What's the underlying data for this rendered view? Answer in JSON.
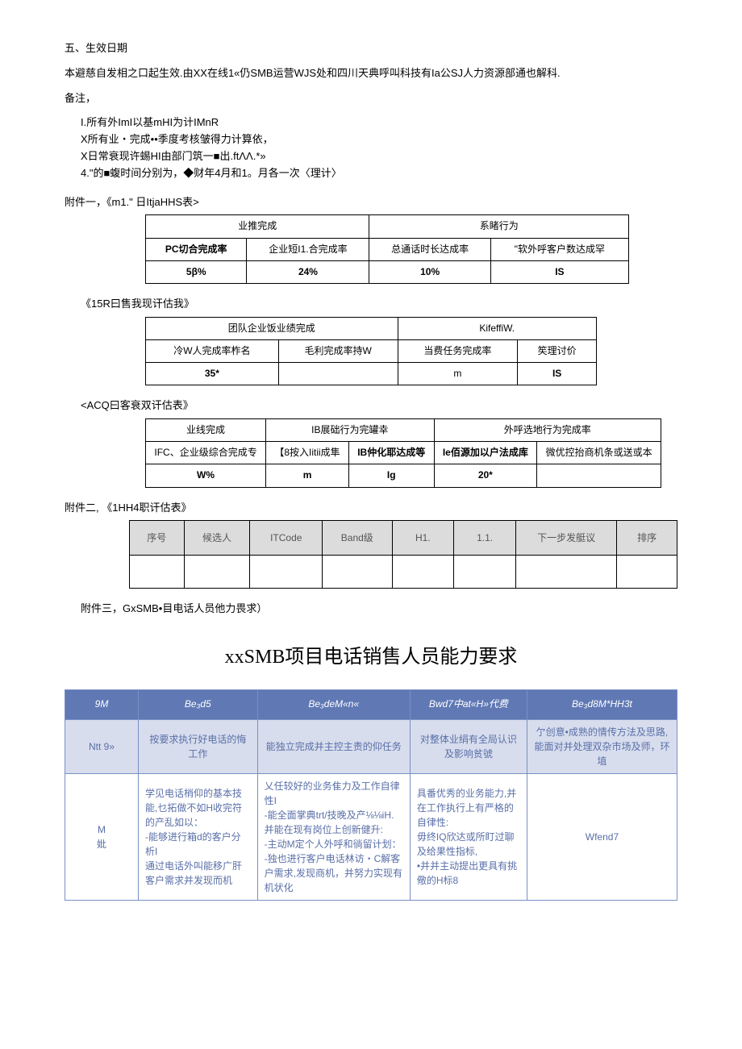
{
  "section5_title": "五、生效日期",
  "section5_body": "本避慈自发相之口起生效.由XX在线1«仍SMB运营WJS处和四川天典呼叫科技有Ia公SJ人力资源部通也解科.",
  "notes_title": "备注，",
  "notes": [
    "I.所有外ImI以基mHI为计IMnR",
    "X所有业・完成••季度考核皱得力计算依，",
    "X日常衰现许蜴HI由部门筑一■出.ftΛΛ.*»",
    "4.\"的■蝮时间分别为，◆财年4月和1。月各一次〈理计〉"
  ],
  "attach1_label": "附件一，《m1.\" 日ItjaHHS表>",
  "t1": {
    "h1": "业推完成",
    "h2": "系睹行为",
    "c1": "PC切合完成率",
    "c2": "企业短I1.合完成率",
    "c3": "总通话时长达成率",
    "c4": "\"软外呼客户数达成罕",
    "v1": "5β%",
    "v2": "24%",
    "v3": "10%",
    "v4": "IS"
  },
  "t2_label": "《15R曰售我现讦估我》",
  "t2": {
    "h1": "团队企业饭业绩完成",
    "h2": "KifeffiW.",
    "c1": "冷W人完成率柞名",
    "c2": "毛利完成率持W",
    "c3": "当费任务完成率",
    "c4": "笶理讨价",
    "v1": "35*",
    "v2": "",
    "v3": "m",
    "v4": "IS"
  },
  "t3_label": "<ACQ曰客衰双讦估表》",
  "t3": {
    "h1": "业线完成",
    "h2": "IB展础行为完罐幸",
    "h3": "外呼选地行为完成率",
    "c1": "IFC、企业级综合完成专",
    "c2": "【8按入Iitii成隼",
    "c3": "IB仲化耶达成等",
    "c4": "Ie佰源加以户法成库",
    "c5": "微优控抬商机条或送或本",
    "v1": "W%",
    "v2": "m",
    "v3": "Ig",
    "v4": "20*",
    "v5": ""
  },
  "attach2_label": "附件二, 《1HH4职讦估表》",
  "t4": {
    "h1": "序号",
    "h2": "候选人",
    "h3": "ITCode",
    "h4": "Band级",
    "h5": "H1.",
    "h6": "1.1.",
    "h7": "下一步发艇议",
    "h8": "排序"
  },
  "attach3_label": "附件三，GxSMB•目电话人员他力畏求）",
  "big_title": "xxSMB项目电话销售人员能力要求",
  "t5": {
    "h1": "9M",
    "h2": "Be₃d5",
    "h3": "Be₃deM«n«",
    "h4": "Bwd7中at«H»代费",
    "h5": "Be₃d8M*HH3t",
    "r1c1": "Ntt 9»",
    "r1c2": "按要求执行好电话的悔工作",
    "r1c3": "能独立完成并主控主责的仰任务",
    "r1c4": "对整体业绢有全局认识及影响贫號",
    "r1c5": "亇创意•成熟的情传方法及思路,能面对并处理双杂市场及师，环埴",
    "r2c1": "M\n妣",
    "r2c2": "学见电话梢仰的基本技能,乜拓做不如H收完符的产乱如以：\n-能够进行箱d的客户分析I\n 通过电话外叫能移广肝客户需求并发现而机",
    "r2c3": "乂任较好的业务隹力及工作自律性I\n-能全面掌典trt/技晚及产⅛⅛iH.并能在现有岗位上创新健升:\n-主动M定个人外呼和徜留计划：\n-独也进行客户电话林访・C解客户需求,发现商机，并努力实现有机状化",
    "r2c4": "具番优秀的业务能力,并在工作执行上有严格的自律性:\n 毋终IQ欣达或所盯过聊及给果性指标,\n•并并主动提出更具有挑儆的H标8",
    "r2c5": "Wfend7"
  }
}
